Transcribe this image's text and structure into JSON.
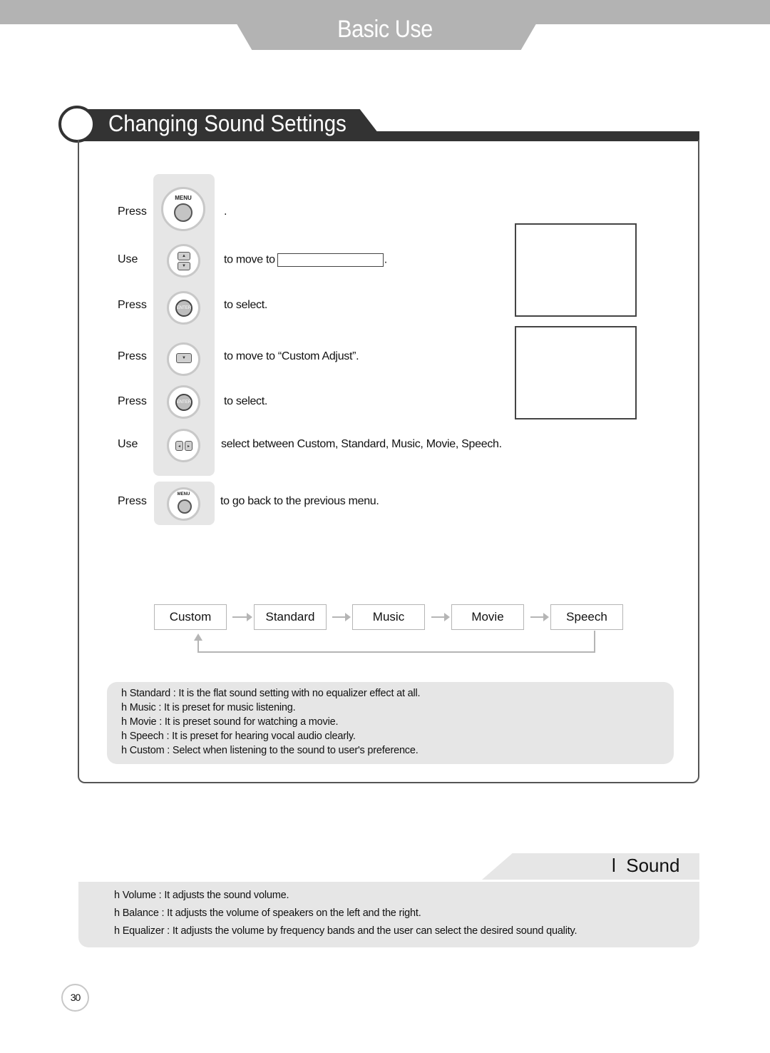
{
  "header": {
    "title": "Basic Use"
  },
  "section": {
    "title": "Changing Sound Settings"
  },
  "steps": [
    {
      "verb": "Press",
      "button": "menu-button",
      "button_label": "MENU",
      "text": "."
    },
    {
      "verb": "Use",
      "button": "up-down-button",
      "text_before": "to move to",
      "text_after": "."
    },
    {
      "verb": "Press",
      "button": "enter-button",
      "button_label": "ENTER",
      "text": "to select."
    },
    {
      "verb": "Press",
      "button": "down-button",
      "text": "to move to “Custom Adjust”."
    },
    {
      "verb": "Press",
      "button": "enter-button",
      "button_label": "ENTER",
      "text": "to select."
    },
    {
      "verb": "Use",
      "button": "left-right-button",
      "text": "select between Custom, Standard, Music, Movie, Speech."
    },
    {
      "verb": "Press",
      "button": "menu-button",
      "button_label": "MENU",
      "text": "to go back to the previous menu."
    }
  ],
  "flow": {
    "modes": [
      "Custom",
      "Standard",
      "Music",
      "Movie",
      "Speech"
    ]
  },
  "notes": [
    "h Standard : It is the flat sound setting with no equalizer effect at all.",
    "h Music : It is preset for music listening.",
    "h Movie : It is preset sound for watching a movie.",
    "h Speech : It is preset for hearing vocal audio clearly.",
    "h Custom : Select when listening to the sound to user's preference."
  ],
  "sound": {
    "title": "l  Sound",
    "items": [
      "h Volume : It adjusts the sound volume.",
      "h Balance : It adjusts the volume of speakers on the left and the right.",
      "h Equalizer : It adjusts the volume by frequency bands and the user can select the desired sound quality."
    ]
  },
  "page_number": "30"
}
